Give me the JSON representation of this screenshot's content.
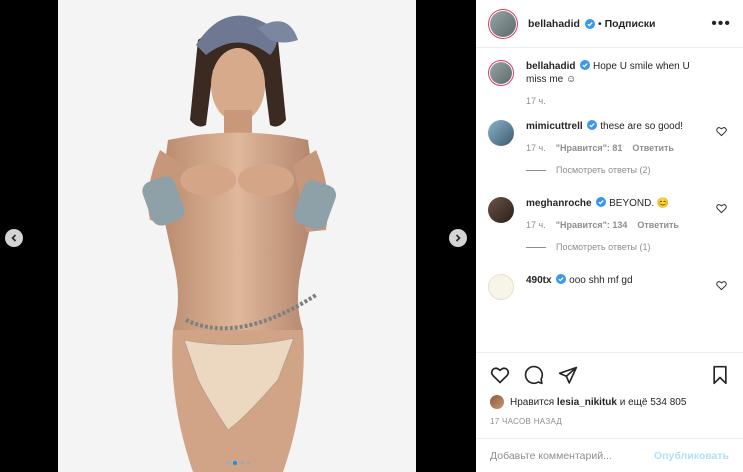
{
  "post": {
    "carousel": {
      "total": 4,
      "active_index": 1
    },
    "header": {
      "username": "bellahadid",
      "separator": "•",
      "follow_label": "Подписки",
      "more": "•••"
    },
    "caption": {
      "username": "bellahadid",
      "text": "Hope U smile when U miss me ☺",
      "time": "17 ч."
    },
    "comments": [
      {
        "username": "mimicuttrell",
        "text": "these are so good!",
        "time": "17 ч.",
        "likes": "\"Нравится\": 81",
        "reply": "Ответить",
        "view_replies": "Посмотреть ответы (2)"
      },
      {
        "username": "meghanroche",
        "text": "BEYOND. 😊",
        "time": "17 ч.",
        "likes": "\"Нравится\": 134",
        "reply": "Ответить",
        "view_replies": "Посмотреть ответы (1)"
      },
      {
        "username": "490tx",
        "text": "ooo shh mf gd",
        "time": "",
        "likes": "",
        "reply": "",
        "view_replies": ""
      }
    ],
    "likes": {
      "prefix": "Нравится",
      "user": "lesia_nikituk",
      "suffix": "и ещё 534 805"
    },
    "timestamp": "17 ЧАСОВ НАЗАД",
    "add_comment": {
      "placeholder": "Добавьте комментарий...",
      "post_label": "Опубликовать"
    }
  },
  "colors": {
    "verified": "#3897f0",
    "accent_dot": "#0095f6",
    "post_disabled": "#b2dffc"
  },
  "icons": [
    "chevron-left-icon",
    "chevron-right-icon",
    "more-icon",
    "verified-icon",
    "heart-icon",
    "comment-icon",
    "share-icon",
    "bookmark-icon"
  ]
}
